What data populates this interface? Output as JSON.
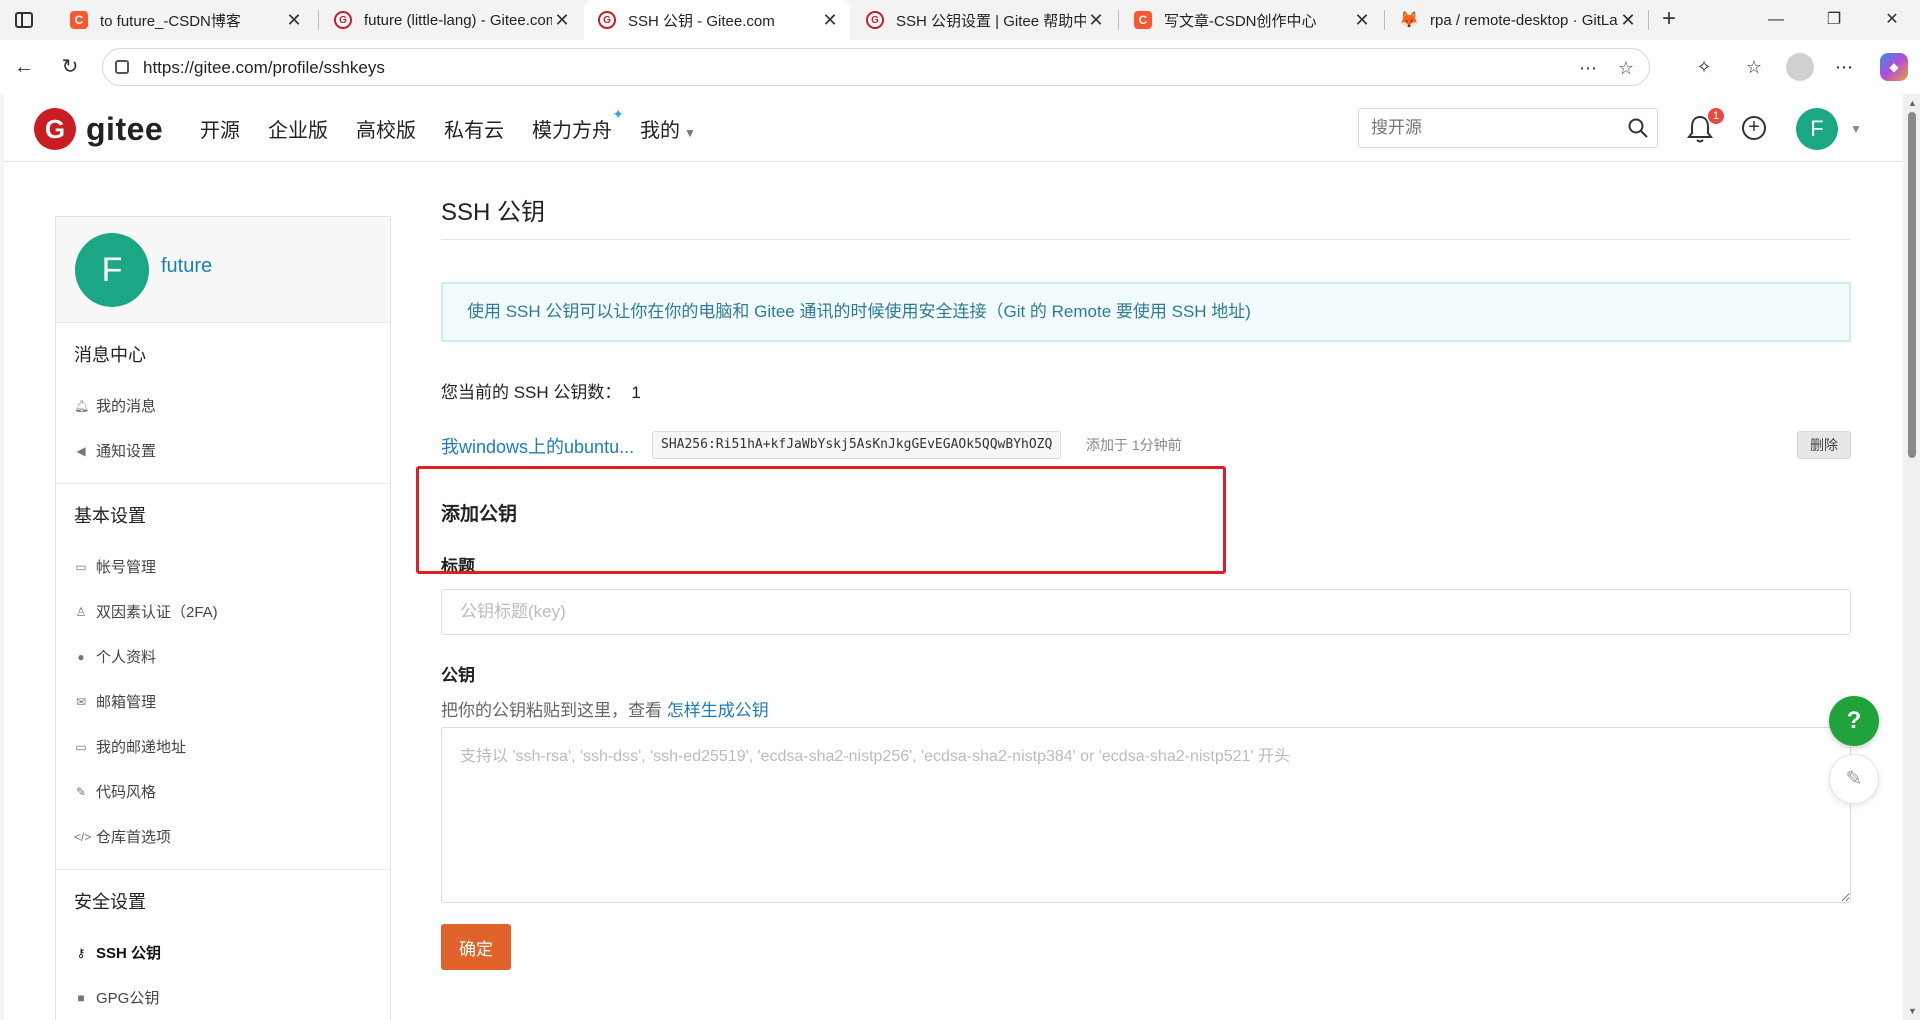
{
  "browser": {
    "tabs": [
      {
        "title": "to future_-CSDN博客",
        "icon": "csdn-icon"
      },
      {
        "title": "future (little-lang) - Gitee.com",
        "icon": "gitee-icon"
      },
      {
        "title": "SSH 公钥 - Gitee.com",
        "icon": "gitee-icon",
        "active": true
      },
      {
        "title": "SSH 公钥设置 | Gitee 帮助中心",
        "icon": "gitee-icon"
      },
      {
        "title": "写文章-CSDN创作中心",
        "icon": "csdn-icon"
      },
      {
        "title": "rpa / remote-desktop · GitLab",
        "icon": "gitlab-icon"
      }
    ],
    "url": "https://gitee.com/profile/sshkeys"
  },
  "header": {
    "logo_text": "gitee",
    "nav": [
      "开源",
      "企业版",
      "高校版",
      "私有云",
      "模力方舟",
      "我的"
    ],
    "search_placeholder": "搜开源",
    "notification_count": "1",
    "user_initial": "F"
  },
  "sidebar": {
    "avatar_initial": "F",
    "username": "future",
    "groups": [
      {
        "title": "消息中心",
        "items": [
          {
            "label": "我的消息",
            "icon": "bell-icon"
          },
          {
            "label": "通知设置",
            "icon": "speaker-icon"
          }
        ]
      },
      {
        "title": "基本设置",
        "items": [
          {
            "label": "帐号管理",
            "icon": "id-card-icon"
          },
          {
            "label": "双因素认证（2FA)",
            "icon": "user-shield-icon"
          },
          {
            "label": "个人资料",
            "icon": "user-icon"
          },
          {
            "label": "邮箱管理",
            "icon": "envelope-icon"
          },
          {
            "label": "我的邮递地址",
            "icon": "address-card-icon"
          },
          {
            "label": "代码风格",
            "icon": "brush-icon"
          },
          {
            "label": "仓库首选项",
            "icon": "code-icon"
          }
        ]
      },
      {
        "title": "安全设置",
        "items": [
          {
            "label": "SSH 公钥",
            "icon": "key-icon",
            "active": true
          },
          {
            "label": "GPG公钥",
            "icon": "lock-icon"
          }
        ]
      }
    ]
  },
  "main": {
    "title": "SSH 公钥",
    "info": "使用 SSH 公钥可以让你在你的电脑和 Gitee 通讯的时候使用安全连接（Git 的 Remote 要使用 SSH 地址)",
    "key_count_label": "您当前的 SSH 公钥数：",
    "key_count": "1",
    "keys": [
      {
        "name": "我windows上的ubuntu...",
        "fingerprint": "SHA256:Ri51hA+kfJaWbYskj5AsKnJkgGEvEGAOk5QQwBYhOZQ",
        "added": "添加于 1分钟前",
        "delete_label": "删除"
      }
    ],
    "add_title": "添加公钥",
    "title_label": "标题",
    "title_placeholder": "公钥标题(key)",
    "key_label": "公钥",
    "key_hint": "把你的公钥粘贴到这里，查看",
    "key_hint_link": "怎样生成公钥",
    "key_placeholder": "支持以 'ssh-rsa', 'ssh-dss', 'ssh-ed25519', 'ecdsa-sha2-nistp256', 'ecdsa-sha2-nistp384' or 'ecdsa-sha2-nistp521' 开头",
    "submit_label": "确定"
  },
  "floating": {
    "help": "?"
  },
  "colors": {
    "brand": "#c71d23",
    "accent": "#e0632c",
    "link": "#1f7db8",
    "avatar": "#1ba784",
    "highlight": "#e21e24"
  }
}
